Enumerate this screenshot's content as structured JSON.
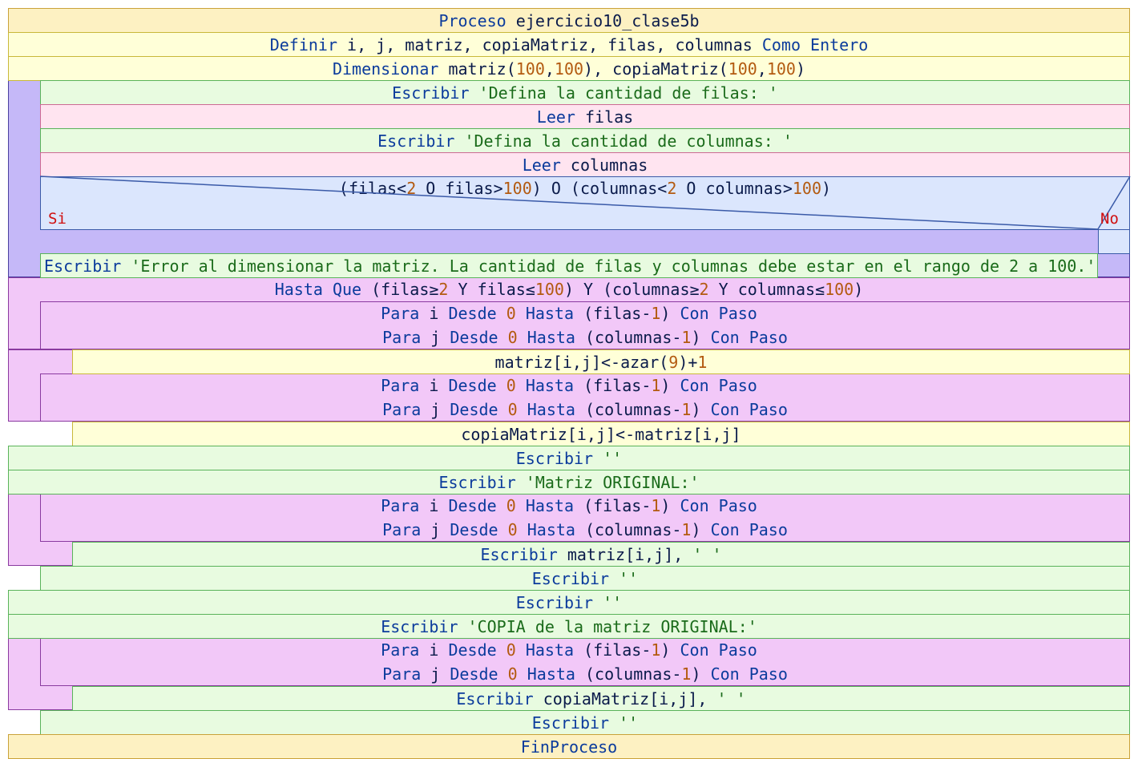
{
  "diagram": {
    "colors": {
      "kw": "#0b3b9c",
      "text": "#0a1a4a",
      "num": "#b35a10",
      "str": "#1a6b1a",
      "si_no": "#d01010",
      "proc_fill": "#fdf1c2",
      "proc_border": "#c9a23a",
      "def_fill": "#ffffd8",
      "def_border": "#c9b83a",
      "write_fill": "#e8fbe0",
      "write_border": "#5ab35a",
      "read_fill": "#ffe4f0",
      "read_border": "#cc6a94",
      "repeat_fill": "#c5b8f8",
      "repeat_border": "#4a3fa0",
      "cond_fill": "#dbe6fd",
      "cond_border": "#3a5aa8",
      "for_fill": "#f2c8f8",
      "for_border": "#8a3aa0"
    },
    "lines": [
      [
        {
          "t": "Proceso",
          "c": "kw"
        },
        {
          "t": " ejercicio10_clase5b",
          "c": "text"
        }
      ],
      [
        {
          "t": "Definir",
          "c": "kw"
        },
        {
          "t": " i, j, matriz, copiaMatriz, filas, columnas ",
          "c": "text"
        },
        {
          "t": "Como Entero",
          "c": "kw"
        }
      ],
      [
        {
          "t": "Dimensionar",
          "c": "kw"
        },
        {
          "t": " matriz(",
          "c": "text"
        },
        {
          "t": "100",
          "c": "num"
        },
        {
          "t": ",",
          "c": "text"
        },
        {
          "t": "100",
          "c": "num"
        },
        {
          "t": "), copiaMatriz(",
          "c": "text"
        },
        {
          "t": "100",
          "c": "num"
        },
        {
          "t": ",",
          "c": "text"
        },
        {
          "t": "100",
          "c": "num"
        },
        {
          "t": ")",
          "c": "text"
        }
      ],
      [
        {
          "t": "Escribir",
          "c": "kw"
        },
        {
          "t": " 'Defina la cantidad de filas: '",
          "c": "str"
        }
      ],
      [
        {
          "t": "Leer",
          "c": "kw"
        },
        {
          "t": " filas",
          "c": "text"
        }
      ],
      [
        {
          "t": "Escribir",
          "c": "kw"
        },
        {
          "t": " 'Defina la cantidad de columnas: '",
          "c": "str"
        }
      ],
      [
        {
          "t": "Leer",
          "c": "kw"
        },
        {
          "t": " columnas",
          "c": "text"
        }
      ],
      [
        {
          "t": "(filas<",
          "c": "text"
        },
        {
          "t": "2",
          "c": "num"
        },
        {
          "t": " O filas>",
          "c": "text"
        },
        {
          "t": "100",
          "c": "num"
        },
        {
          "t": ") O (columnas<",
          "c": "text"
        },
        {
          "t": "2",
          "c": "num"
        },
        {
          "t": " O columnas>",
          "c": "text"
        },
        {
          "t": "100",
          "c": "num"
        },
        {
          "t": ")",
          "c": "text"
        }
      ],
      [
        {
          "t": "Escribir",
          "c": "kw"
        },
        {
          "t": " 'Error al dimensionar la matriz. La cantidad de filas y columnas debe estar en el rango de 2 a 100.'",
          "c": "str"
        }
      ],
      [
        {
          "t": "Hasta Que",
          "c": "kw"
        },
        {
          "t": " (filas≥",
          "c": "text"
        },
        {
          "t": "2",
          "c": "num"
        },
        {
          "t": " Y filas≤",
          "c": "text"
        },
        {
          "t": "100",
          "c": "num"
        },
        {
          "t": ") Y (columnas≥",
          "c": "text"
        },
        {
          "t": "2",
          "c": "num"
        },
        {
          "t": " Y columnas≤",
          "c": "text"
        },
        {
          "t": "100",
          "c": "num"
        },
        {
          "t": ")",
          "c": "text"
        }
      ],
      [
        {
          "t": "Para",
          "c": "kw"
        },
        {
          "t": " i ",
          "c": "text"
        },
        {
          "t": "Desde",
          "c": "kw"
        },
        {
          "t": " ",
          "c": "text"
        },
        {
          "t": "0",
          "c": "num"
        },
        {
          "t": " ",
          "c": "text"
        },
        {
          "t": "Hasta",
          "c": "kw"
        },
        {
          "t": " (filas-",
          "c": "text"
        },
        {
          "t": "1",
          "c": "num"
        },
        {
          "t": ") ",
          "c": "text"
        },
        {
          "t": "Con Paso",
          "c": "kw"
        }
      ],
      [
        {
          "t": "Para",
          "c": "kw"
        },
        {
          "t": " j ",
          "c": "text"
        },
        {
          "t": "Desde",
          "c": "kw"
        },
        {
          "t": " ",
          "c": "text"
        },
        {
          "t": "0",
          "c": "num"
        },
        {
          "t": " ",
          "c": "text"
        },
        {
          "t": "Hasta",
          "c": "kw"
        },
        {
          "t": " (columnas-",
          "c": "text"
        },
        {
          "t": "1",
          "c": "num"
        },
        {
          "t": ") ",
          "c": "text"
        },
        {
          "t": "Con Paso",
          "c": "kw"
        }
      ],
      [
        {
          "t": "matriz[i,j]<-azar(",
          "c": "text"
        },
        {
          "t": "9",
          "c": "num"
        },
        {
          "t": ")+",
          "c": "text"
        },
        {
          "t": "1",
          "c": "num"
        }
      ],
      [
        {
          "t": "Para",
          "c": "kw"
        },
        {
          "t": " i ",
          "c": "text"
        },
        {
          "t": "Desde",
          "c": "kw"
        },
        {
          "t": " ",
          "c": "text"
        },
        {
          "t": "0",
          "c": "num"
        },
        {
          "t": " ",
          "c": "text"
        },
        {
          "t": "Hasta",
          "c": "kw"
        },
        {
          "t": " (filas-",
          "c": "text"
        },
        {
          "t": "1",
          "c": "num"
        },
        {
          "t": ") ",
          "c": "text"
        },
        {
          "t": "Con Paso",
          "c": "kw"
        }
      ],
      [
        {
          "t": "Para",
          "c": "kw"
        },
        {
          "t": " j ",
          "c": "text"
        },
        {
          "t": "Desde",
          "c": "kw"
        },
        {
          "t": " ",
          "c": "text"
        },
        {
          "t": "0",
          "c": "num"
        },
        {
          "t": " ",
          "c": "text"
        },
        {
          "t": "Hasta",
          "c": "kw"
        },
        {
          "t": " (columnas-",
          "c": "text"
        },
        {
          "t": "1",
          "c": "num"
        },
        {
          "t": ") ",
          "c": "text"
        },
        {
          "t": "Con Paso",
          "c": "kw"
        }
      ],
      [
        {
          "t": "copiaMatriz[i,j]<-matriz[i,j]",
          "c": "text"
        }
      ],
      [
        {
          "t": "Escribir",
          "c": "kw"
        },
        {
          "t": " ''",
          "c": "str"
        }
      ],
      [
        {
          "t": "Escribir",
          "c": "kw"
        },
        {
          "t": " 'Matriz ORIGINAL:'",
          "c": "str"
        }
      ],
      [
        {
          "t": "Para",
          "c": "kw"
        },
        {
          "t": " i ",
          "c": "text"
        },
        {
          "t": "Desde",
          "c": "kw"
        },
        {
          "t": " ",
          "c": "text"
        },
        {
          "t": "0",
          "c": "num"
        },
        {
          "t": " ",
          "c": "text"
        },
        {
          "t": "Hasta",
          "c": "kw"
        },
        {
          "t": " (filas-",
          "c": "text"
        },
        {
          "t": "1",
          "c": "num"
        },
        {
          "t": ") ",
          "c": "text"
        },
        {
          "t": "Con Paso",
          "c": "kw"
        }
      ],
      [
        {
          "t": "Para",
          "c": "kw"
        },
        {
          "t": " j ",
          "c": "text"
        },
        {
          "t": "Desde",
          "c": "kw"
        },
        {
          "t": " ",
          "c": "text"
        },
        {
          "t": "0",
          "c": "num"
        },
        {
          "t": " ",
          "c": "text"
        },
        {
          "t": "Hasta",
          "c": "kw"
        },
        {
          "t": " (columnas-",
          "c": "text"
        },
        {
          "t": "1",
          "c": "num"
        },
        {
          "t": ") ",
          "c": "text"
        },
        {
          "t": "Con Paso",
          "c": "kw"
        }
      ],
      [
        {
          "t": "Escribir",
          "c": "kw"
        },
        {
          "t": " matriz[i,j], ",
          "c": "text"
        },
        {
          "t": "' '",
          "c": "str"
        }
      ],
      [
        {
          "t": "Escribir",
          "c": "kw"
        },
        {
          "t": " ''",
          "c": "str"
        }
      ],
      [
        {
          "t": "Escribir",
          "c": "kw"
        },
        {
          "t": " ''",
          "c": "str"
        }
      ],
      [
        {
          "t": "Escribir",
          "c": "kw"
        },
        {
          "t": " 'COPIA de la matriz ORIGINAL:'",
          "c": "str"
        }
      ],
      [
        {
          "t": "Para",
          "c": "kw"
        },
        {
          "t": " i ",
          "c": "text"
        },
        {
          "t": "Desde",
          "c": "kw"
        },
        {
          "t": " ",
          "c": "text"
        },
        {
          "t": "0",
          "c": "num"
        },
        {
          "t": " ",
          "c": "text"
        },
        {
          "t": "Hasta",
          "c": "kw"
        },
        {
          "t": " (filas-",
          "c": "text"
        },
        {
          "t": "1",
          "c": "num"
        },
        {
          "t": ") ",
          "c": "text"
        },
        {
          "t": "Con Paso",
          "c": "kw"
        }
      ],
      [
        {
          "t": "Para",
          "c": "kw"
        },
        {
          "t": " j ",
          "c": "text"
        },
        {
          "t": "Desde",
          "c": "kw"
        },
        {
          "t": " ",
          "c": "text"
        },
        {
          "t": "0",
          "c": "num"
        },
        {
          "t": " ",
          "c": "text"
        },
        {
          "t": "Hasta",
          "c": "kw"
        },
        {
          "t": " (columnas-",
          "c": "text"
        },
        {
          "t": "1",
          "c": "num"
        },
        {
          "t": ") ",
          "c": "text"
        },
        {
          "t": "Con Paso",
          "c": "kw"
        }
      ],
      [
        {
          "t": "Escribir",
          "c": "kw"
        },
        {
          "t": " copiaMatriz[i,j], ",
          "c": "text"
        },
        {
          "t": "' '",
          "c": "str"
        }
      ],
      [
        {
          "t": "Escribir",
          "c": "kw"
        },
        {
          "t": " ''",
          "c": "str"
        }
      ],
      [
        {
          "t": "FinProceso",
          "c": "kw"
        }
      ]
    ],
    "cond_labels": {
      "yes": "Si",
      "no": "No"
    }
  }
}
